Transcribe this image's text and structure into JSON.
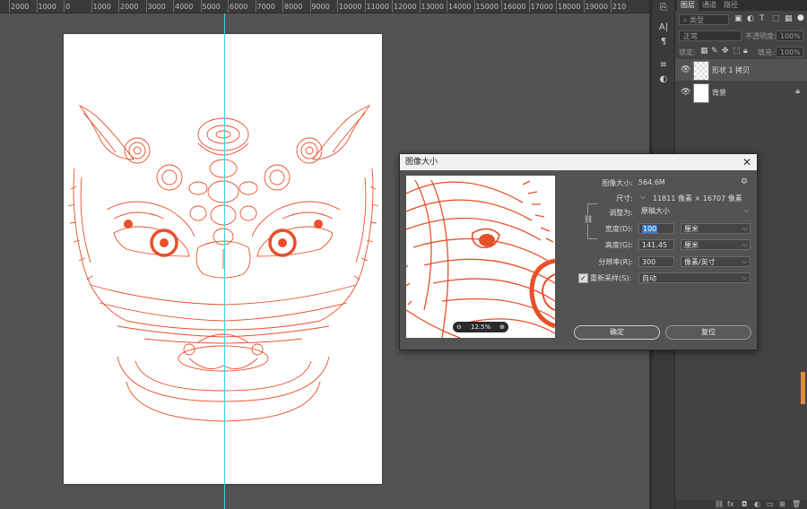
{
  "ruler": {
    "ticks": [
      "2000",
      "1000",
      "0",
      "1000",
      "2000",
      "3000",
      "4000",
      "5000",
      "6000",
      "7000",
      "8000",
      "9000",
      "10000",
      "11000",
      "12000",
      "13000",
      "14000",
      "15000",
      "16000",
      "17000",
      "18000",
      "19000",
      "210"
    ]
  },
  "layers_panel": {
    "tabs": [
      "图层",
      "通道",
      "路径"
    ],
    "search_placeholder": "类型",
    "blend_mode": "正常",
    "opacity_label": "不透明度:",
    "opacity_value": "100%",
    "lock_label": "锁定:",
    "fill_label": "填充:",
    "fill_value": "100%",
    "layers": [
      {
        "name": "形状 1 拷贝",
        "selected": true
      },
      {
        "name": "背景",
        "locked": true
      }
    ],
    "footer_icons": [
      "link-icon",
      "fx-icon",
      "mask-icon",
      "adjustment-icon",
      "group-icon",
      "new-layer-icon",
      "trash-icon"
    ]
  },
  "dialog": {
    "title": "图像大小",
    "close": "✕",
    "image_size_label": "图像大小:",
    "image_size_value": "564.6M",
    "dimensions_label": "尺寸:",
    "dimensions_value": "11811 像素 × 16707 像素",
    "fit_to_label": "调整为:",
    "fit_to_value": "原稿大小",
    "width_label": "宽度(D):",
    "width_value": "100",
    "width_unit": "厘米",
    "height_label": "高度(G):",
    "height_value": "141.45",
    "height_unit": "厘米",
    "resolution_label": "分辨率(R):",
    "resolution_value": "300",
    "resolution_unit": "像素/英寸",
    "resample_label": "重新采样(S):",
    "resample_value": "自动",
    "zoom_value": "12.5%",
    "ok_label": "确定",
    "reset_label": "复位"
  },
  "colors": {
    "artwork": "#e8502a",
    "guide": "#39d4df",
    "accent_selection": "#2f7fd0"
  }
}
